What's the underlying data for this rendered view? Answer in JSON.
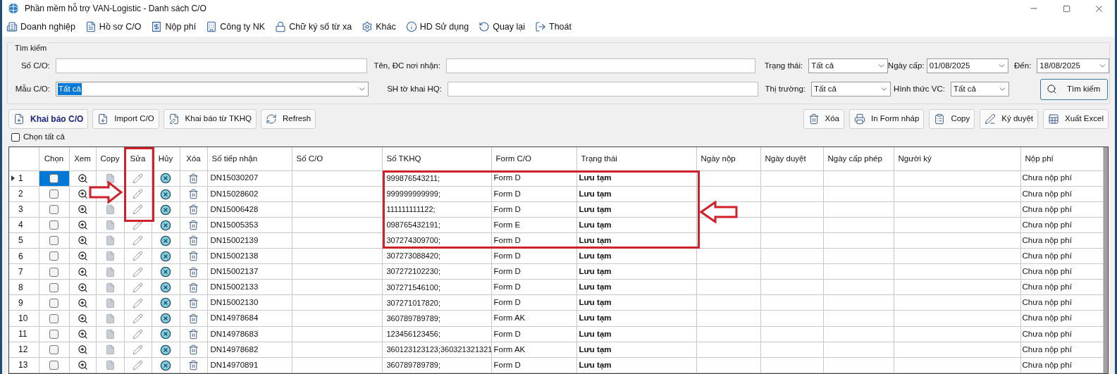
{
  "window": {
    "title": "Phần mềm hỗ trợ VAN-Logistic - Danh sách C/O"
  },
  "menu": [
    {
      "label": "Doanh nghiệp"
    },
    {
      "label": "Hồ sơ C/O"
    },
    {
      "label": "Nộp phí"
    },
    {
      "label": "Công ty NK"
    },
    {
      "label": "Chữ ký số từ xa"
    },
    {
      "label": "Khác"
    },
    {
      "label": "HD Sử dụng"
    },
    {
      "label": "Quay lại"
    },
    {
      "label": "Thoát"
    }
  ],
  "search": {
    "title": "Tìm kiếm",
    "so_co": {
      "label": "Số C/O:"
    },
    "mau_co": {
      "label": "Mẫu C/O:",
      "value": "Tất cả"
    },
    "noi_nhan": {
      "label": "Tên, ĐC nơi nhận:"
    },
    "sh_to_khai": {
      "label": "SH tờ khai HQ:"
    },
    "trang_thai": {
      "label": "Trạng thái:",
      "value": "Tất cả"
    },
    "thi_truong": {
      "label": "Thị trường:",
      "value": "Tất cả"
    },
    "ngay_cap": {
      "label": "Ngày cấp:",
      "value": "01/08/2025"
    },
    "den": {
      "label": "Đến:",
      "value": "18/08/2025"
    },
    "hinh_thuc": {
      "label": "Hình thức VC:",
      "value": "Tất cả"
    },
    "button": "Tìm kiếm"
  },
  "actions_left": [
    {
      "label": "Khai báo C/O",
      "primary": true
    },
    {
      "label": "Import C/O",
      "primary": false
    },
    {
      "label": "Khai báo từ TKHQ",
      "primary": false
    },
    {
      "label": "Refresh",
      "primary": false
    }
  ],
  "actions_right": [
    {
      "label": "Xóa"
    },
    {
      "label": "In Form nháp"
    },
    {
      "label": "Copy"
    },
    {
      "label": "Ký duyệt"
    },
    {
      "label": "Xuất Excel"
    }
  ],
  "select_all": {
    "label": "Chọn tất cả",
    "checked": false
  },
  "table": {
    "columns": [
      "Chọn",
      "Xem",
      "Copy",
      "Sửa",
      "Hủy",
      "Xóa",
      "Số tiếp nhận",
      "Số C/O",
      "Số TKHQ",
      "Form C/O",
      "Trạng thái",
      "Ngày nộp",
      "Ngày duyệt",
      "Ngày cấp phép",
      "Người ký",
      "Nộp phí"
    ],
    "rows": [
      {
        "no": "1",
        "selected": true,
        "checked": false,
        "so_tiep_nhan": "DN15030207",
        "so_tkhq": "999876543211;",
        "form": "Form D",
        "trang_thai": "Lưu tạm",
        "nop_phi": "Chưa nộp phí"
      },
      {
        "no": "2",
        "selected": false,
        "checked": false,
        "so_tiep_nhan": "DN15028602",
        "so_tkhq": "999999999999;",
        "form": "Form D",
        "trang_thai": "Lưu tạm",
        "nop_phi": "Chưa nộp phí"
      },
      {
        "no": "3",
        "selected": false,
        "checked": false,
        "so_tiep_nhan": "DN15006428",
        "so_tkhq": "111111111122;",
        "form": "Form D",
        "trang_thai": "Lưu tạm",
        "nop_phi": "Chưa nộp phí"
      },
      {
        "no": "4",
        "selected": false,
        "checked": false,
        "so_tiep_nhan": "DN15005353",
        "so_tkhq": "098765432191;",
        "form": "Form E",
        "trang_thai": "Lưu tạm",
        "nop_phi": "Chưa nộp phí"
      },
      {
        "no": "5",
        "selected": false,
        "checked": false,
        "so_tiep_nhan": "DN15002139",
        "so_tkhq": "307274309700;",
        "form": "Form D",
        "trang_thai": "Lưu tạm",
        "nop_phi": "Chưa nộp phí"
      },
      {
        "no": "6",
        "selected": false,
        "checked": false,
        "so_tiep_nhan": "DN15002138",
        "so_tkhq": "307273088420;",
        "form": "Form D",
        "trang_thai": "Lưu tạm",
        "nop_phi": "Chưa nộp phí"
      },
      {
        "no": "7",
        "selected": false,
        "checked": false,
        "so_tiep_nhan": "DN15002137",
        "so_tkhq": "307272102230;",
        "form": "Form D",
        "trang_thai": "Lưu tạm",
        "nop_phi": "Chưa nộp phí"
      },
      {
        "no": "8",
        "selected": false,
        "checked": false,
        "so_tiep_nhan": "DN15002133",
        "so_tkhq": "307271546100;",
        "form": "Form D",
        "trang_thai": "Lưu tạm",
        "nop_phi": "Chưa nộp phí"
      },
      {
        "no": "9",
        "selected": false,
        "checked": false,
        "so_tiep_nhan": "DN15002130",
        "so_tkhq": "307271017820;",
        "form": "Form D",
        "trang_thai": "Lưu tạm",
        "nop_phi": "Chưa nộp phí"
      },
      {
        "no": "10",
        "selected": false,
        "checked": false,
        "so_tiep_nhan": "DN14978684",
        "so_tkhq": "360789789789;",
        "form": "Form AK",
        "trang_thai": "Lưu tạm",
        "nop_phi": "Chưa nộp phí"
      },
      {
        "no": "11",
        "selected": false,
        "checked": false,
        "so_tiep_nhan": "DN14978683",
        "so_tkhq": "123456123456;",
        "form": "Form D",
        "trang_thai": "Lưu tạm",
        "nop_phi": "Chưa nộp phí"
      },
      {
        "no": "12",
        "selected": false,
        "checked": false,
        "so_tiep_nhan": "DN14978682",
        "so_tkhq": "360123123123;360321321321",
        "form": "Form AK",
        "trang_thai": "Lưu tạm",
        "nop_phi": "Chưa nộp phí"
      },
      {
        "no": "13",
        "selected": false,
        "checked": false,
        "so_tiep_nhan": "DN14970891",
        "so_tkhq": "360789789789;",
        "form": "Form D",
        "trang_thai": "Lưu tạm",
        "nop_phi": "Chưa nộp phí"
      }
    ]
  }
}
